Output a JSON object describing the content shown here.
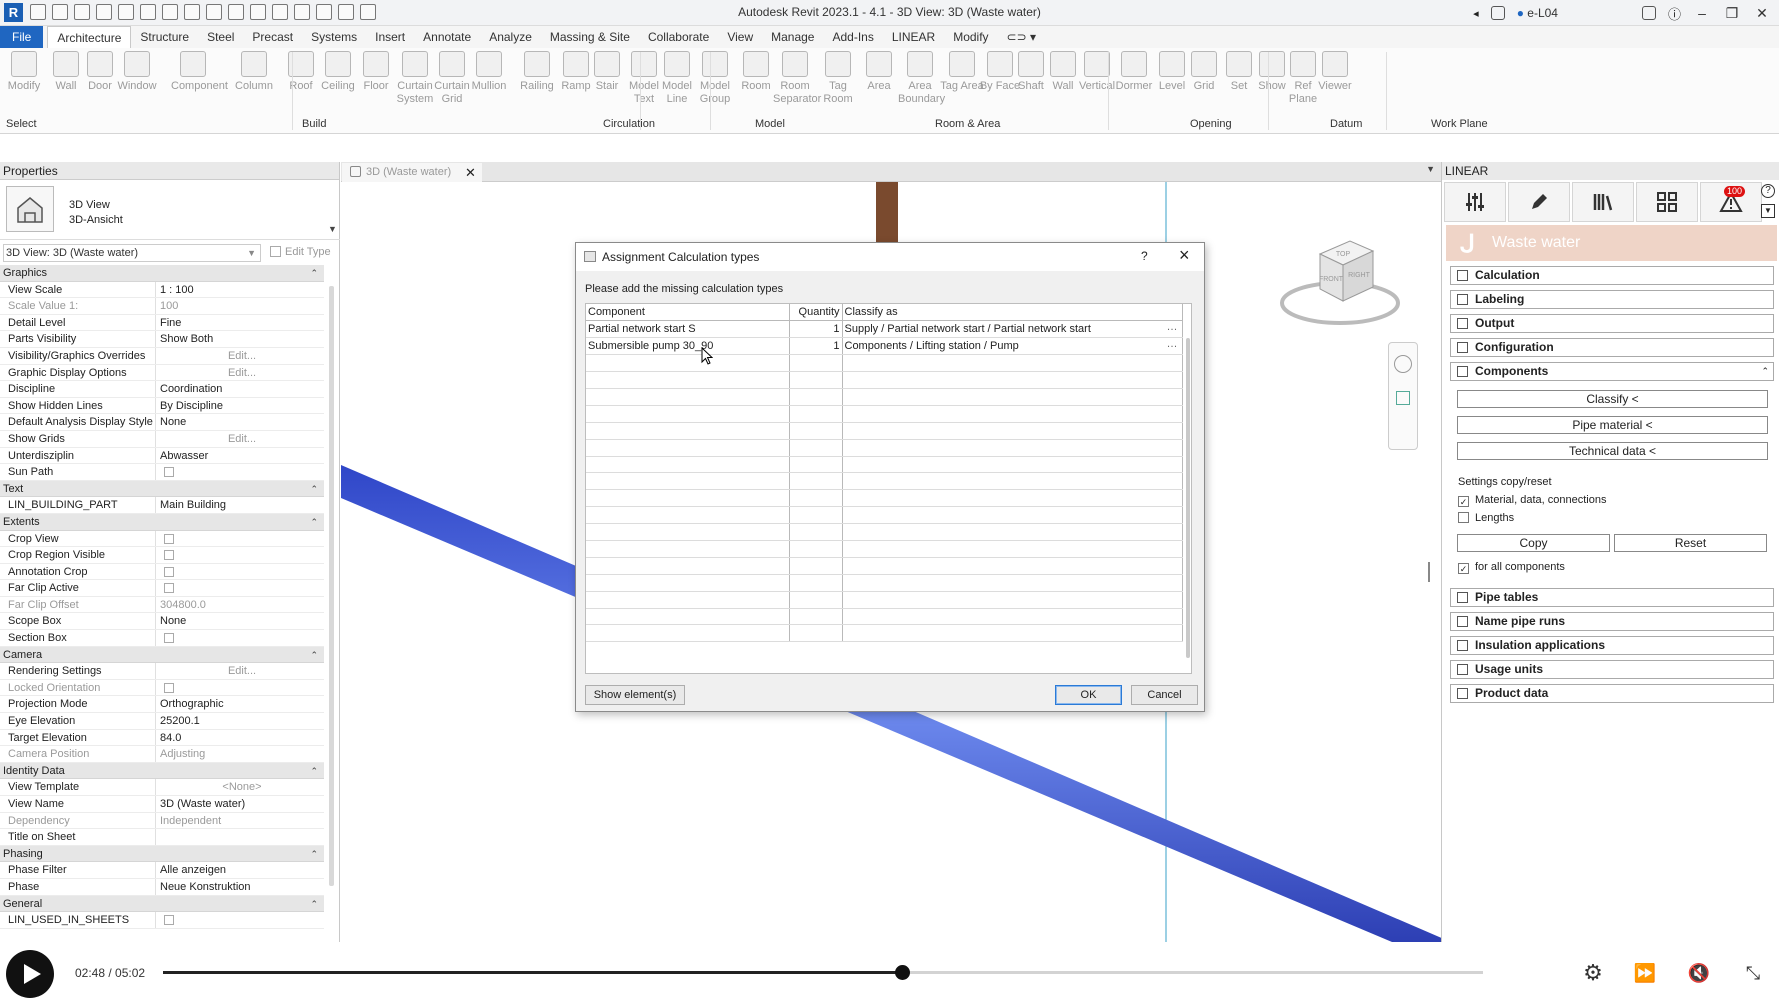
{
  "app": {
    "title": "Autodesk Revit 2023.1 - 4.1 - 3D View: 3D (Waste water)",
    "user": "e-L04",
    "logo": "R"
  },
  "ribbon": {
    "tabs": [
      "File",
      "Architecture",
      "Structure",
      "Steel",
      "Precast",
      "Systems",
      "Insert",
      "Annotate",
      "Analyze",
      "Massing & Site",
      "Collaborate",
      "View",
      "Manage",
      "Add-Ins",
      "LINEAR",
      "Modify"
    ],
    "active_tab": "Architecture",
    "tools": [
      {
        "label": "Modify",
        "icon": "arrow-cursor-icon"
      },
      {
        "label": "Wall",
        "icon": "wall-icon"
      },
      {
        "label": "Door",
        "icon": "door-icon"
      },
      {
        "label": "Window",
        "icon": "window-icon"
      },
      {
        "label": "Component",
        "icon": "component-icon"
      },
      {
        "label": "Column",
        "icon": "column-icon"
      },
      {
        "label": "Roof",
        "icon": "roof-icon"
      },
      {
        "label": "Ceiling",
        "icon": "ceiling-icon"
      },
      {
        "label": "Floor",
        "icon": "floor-icon"
      },
      {
        "label": "Curtain System",
        "icon": "curtain-system-icon"
      },
      {
        "label": "Curtain Grid",
        "icon": "curtain-grid-icon"
      },
      {
        "label": "Mullion",
        "icon": "mullion-icon"
      },
      {
        "label": "Railing",
        "icon": "railing-icon"
      },
      {
        "label": "Ramp",
        "icon": "ramp-icon"
      },
      {
        "label": "Stair",
        "icon": "stair-icon"
      },
      {
        "label": "Model Text",
        "icon": "model-text-icon"
      },
      {
        "label": "Model Line",
        "icon": "model-line-icon"
      },
      {
        "label": "Model Group",
        "icon": "model-group-icon"
      },
      {
        "label": "Room",
        "icon": "room-icon"
      },
      {
        "label": "Room Separator",
        "icon": "room-separator-icon"
      },
      {
        "label": "Tag Room",
        "icon": "tag-room-icon"
      },
      {
        "label": "Area",
        "icon": "area-icon"
      },
      {
        "label": "Area Boundary",
        "icon": "area-boundary-icon"
      },
      {
        "label": "Tag Area",
        "icon": "tag-area-icon"
      },
      {
        "label": "By Face",
        "icon": "by-face-icon"
      },
      {
        "label": "Shaft",
        "icon": "shaft-icon"
      },
      {
        "label": "Wall",
        "icon": "opening-wall-icon"
      },
      {
        "label": "Vertical",
        "icon": "vertical-icon"
      },
      {
        "label": "Dormer",
        "icon": "dormer-icon"
      },
      {
        "label": "Level",
        "icon": "level-icon"
      },
      {
        "label": "Grid",
        "icon": "grid-icon"
      },
      {
        "label": "Set",
        "icon": "set-icon"
      },
      {
        "label": "Show",
        "icon": "show-icon"
      },
      {
        "label": "Ref Plane",
        "icon": "ref-plane-icon"
      },
      {
        "label": "Viewer",
        "icon": "viewer-icon"
      }
    ],
    "groups": [
      "Select",
      "Build",
      "Circulation",
      "Model",
      "Room & Area",
      "Opening",
      "Datum",
      "Work Plane"
    ]
  },
  "properties": {
    "header": "Properties",
    "type_line1": "3D View",
    "type_line2": "3D-Ansicht",
    "instance_selector": "3D View: 3D (Waste water)",
    "edit_type": "Edit Type",
    "sections": [
      {
        "title": "Graphics",
        "rows": [
          {
            "name": "View Scale",
            "value": "1 : 100"
          },
          {
            "name": "Scale Value    1:",
            "value": "100",
            "grey": true
          },
          {
            "name": "Detail Level",
            "value": "Fine"
          },
          {
            "name": "Parts Visibility",
            "value": "Show Both"
          },
          {
            "name": "Visibility/Graphics Overrides",
            "value": "Edit...",
            "button": true
          },
          {
            "name": "Graphic Display Options",
            "value": "Edit...",
            "button": true
          },
          {
            "name": "Discipline",
            "value": "Coordination"
          },
          {
            "name": "Show Hidden Lines",
            "value": "By Discipline"
          },
          {
            "name": "Default Analysis Display Style",
            "value": "None"
          },
          {
            "name": "Show Grids",
            "value": "Edit...",
            "button": true
          },
          {
            "name": "Unterdisziplin",
            "value": "Abwasser"
          },
          {
            "name": "Sun Path",
            "value": "",
            "checkbox": true
          }
        ]
      },
      {
        "title": "Text",
        "rows": [
          {
            "name": "LIN_BUILDING_PART",
            "value": "Main Building"
          }
        ]
      },
      {
        "title": "Extents",
        "rows": [
          {
            "name": "Crop View",
            "value": "",
            "checkbox": true
          },
          {
            "name": "Crop Region Visible",
            "value": "",
            "checkbox": true
          },
          {
            "name": "Annotation Crop",
            "value": "",
            "checkbox": true
          },
          {
            "name": "Far Clip Active",
            "value": "",
            "checkbox": true
          },
          {
            "name": "Far Clip Offset",
            "value": "304800.0",
            "grey": true
          },
          {
            "name": "Scope Box",
            "value": "None"
          },
          {
            "name": "Section Box",
            "value": "",
            "checkbox": true
          }
        ]
      },
      {
        "title": "Camera",
        "rows": [
          {
            "name": "Rendering Settings",
            "value": "Edit...",
            "button": true
          },
          {
            "name": "Locked Orientation",
            "value": "",
            "checkbox": true,
            "grey": true
          },
          {
            "name": "Projection Mode",
            "value": "Orthographic"
          },
          {
            "name": "Eye Elevation",
            "value": "25200.1"
          },
          {
            "name": "Target Elevation",
            "value": "84.0"
          },
          {
            "name": "Camera Position",
            "value": "Adjusting",
            "grey": true
          }
        ]
      },
      {
        "title": "Identity Data",
        "rows": [
          {
            "name": "View Template",
            "value": "<None>",
            "button": true
          },
          {
            "name": "View Name",
            "value": "3D (Waste water)"
          },
          {
            "name": "Dependency",
            "value": "Independent",
            "grey": true
          },
          {
            "name": "Title on Sheet",
            "value": ""
          }
        ]
      },
      {
        "title": "Phasing",
        "rows": [
          {
            "name": "Phase Filter",
            "value": "Alle anzeigen"
          },
          {
            "name": "Phase",
            "value": "Neue Konstruktion"
          }
        ]
      },
      {
        "title": "General",
        "rows": [
          {
            "name": "LIN_USED_IN_SHEETS",
            "value": "",
            "checkbox": true
          }
        ]
      }
    ]
  },
  "view": {
    "tab_label": "3D (Waste water)",
    "viewcube": {
      "top": "TOP",
      "front": "FRONT",
      "right": "RIGHT"
    }
  },
  "dialog": {
    "title": "Assignment Calculation types",
    "help": "?",
    "instruction": "Please add the missing calculation types",
    "columns": [
      "Component",
      "Quantity",
      "Classify as"
    ],
    "rows": [
      {
        "component": "Partial network start S",
        "quantity": "1",
        "classify": "Supply / Partial network start / Partial network start"
      },
      {
        "component": "Submersible pump 30_90",
        "quantity": "1",
        "classify": "Components / Lifting station / Pump"
      }
    ],
    "empty_rows": 17,
    "show_button": "Show element(s)",
    "ok_button": "OK",
    "cancel_button": "Cancel"
  },
  "linear": {
    "header": "LINEAR",
    "warning_count": "100",
    "help": "?",
    "banner": "Waste water",
    "sections": [
      "Calculation",
      "Labeling",
      "Output",
      "Configuration",
      "Components"
    ],
    "component_buttons": [
      "Classify  <",
      "Pipe material  <",
      "Technical data  <"
    ],
    "settings_title": "Settings copy/reset",
    "checkboxes": [
      {
        "label": "Material, data, connections",
        "checked": true
      },
      {
        "label": "Lengths",
        "checked": false
      }
    ],
    "copy_button": "Copy",
    "reset_button": "Reset",
    "for_all": {
      "label": "for all components",
      "checked": true
    },
    "more_sections": [
      "Pipe tables",
      "Name pipe runs",
      "Insulation applications",
      "Usage units",
      "Product data"
    ]
  },
  "player": {
    "time": "02:48 / 05:02",
    "progress": 0.5598
  },
  "colors": {
    "file_tab": "#1f66c1",
    "pipe": "#4a6be0",
    "linear_banner": "#efd4c7",
    "brown_pipe": "#7a4a2e"
  }
}
